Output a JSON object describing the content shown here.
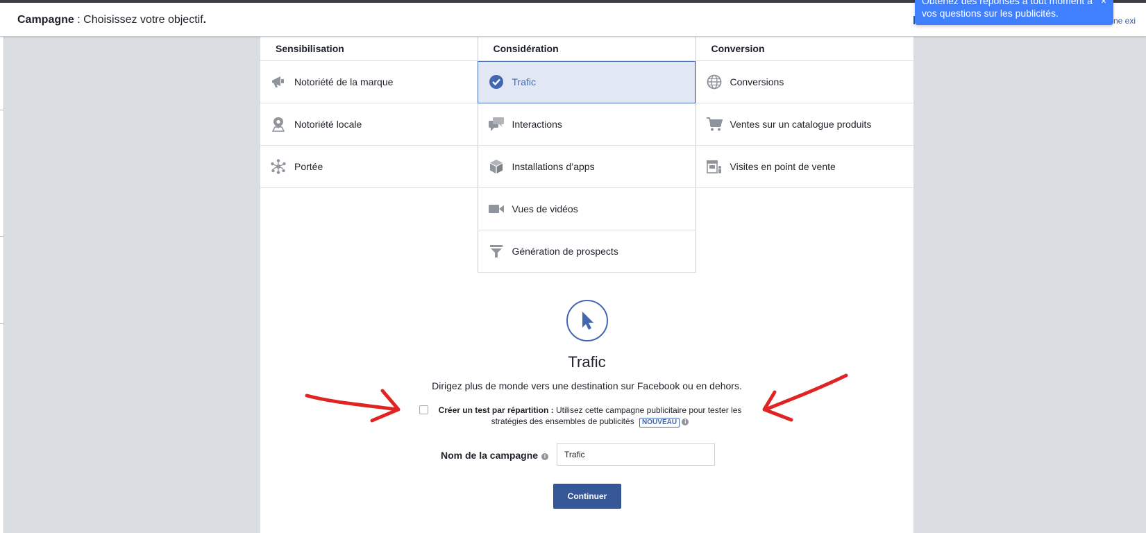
{
  "header": {
    "title_bold": "Campagne",
    "title_rest": " : Choisissez votre objectif",
    "title_dot": ".",
    "right_text": "ne exi"
  },
  "toast": {
    "line1": "Obtenez des réponses à tout moment à",
    "line2": "vos questions sur les publicités.",
    "close": "×"
  },
  "columns": [
    {
      "heading": "Sensibilisation",
      "items": [
        {
          "label": "Notoriété de la marque",
          "icon": "megaphone-icon"
        },
        {
          "label": "Notoriété locale",
          "icon": "map-pin-icon"
        },
        {
          "label": "Portée",
          "icon": "reach-icon"
        }
      ]
    },
    {
      "heading": "Considération",
      "items": [
        {
          "label": "Trafic",
          "icon": "check-circle-icon",
          "selected": true
        },
        {
          "label": "Interactions",
          "icon": "chat-bubbles-icon"
        },
        {
          "label": "Installations d’apps",
          "icon": "box-icon"
        },
        {
          "label": "Vues de vidéos",
          "icon": "video-camera-icon"
        },
        {
          "label": "Génération de prospects",
          "icon": "funnel-icon"
        }
      ]
    },
    {
      "heading": "Conversion",
      "items": [
        {
          "label": "Conversions",
          "icon": "globe-icon"
        },
        {
          "label": "Ventes sur un catalogue produits",
          "icon": "cart-icon"
        },
        {
          "label": "Visites en point de vente",
          "icon": "store-icon"
        }
      ]
    }
  ],
  "detail": {
    "icon": "cursor-icon",
    "title": "Trafic",
    "description": "Dirigez plus de monde vers une destination sur Facebook ou en dehors."
  },
  "split_test": {
    "label_bold": "Créer un test par répartition :",
    "label_text": " Utilisez cette campagne publicitaire pour tester les stratégies des ensembles de publicités",
    "badge": "NOUVEAU",
    "checked": false
  },
  "campaign_name": {
    "label": "Nom de la campagne",
    "value": "Trafic"
  },
  "continue_label": "Continuer",
  "colors": {
    "accent": "#4267b2",
    "button": "#365899",
    "selected_bg": "#e1e8f3",
    "toast": "#4080ff",
    "arrow": "#e02424"
  }
}
